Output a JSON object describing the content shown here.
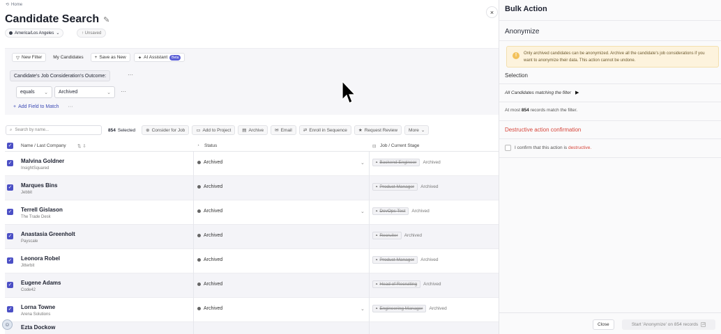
{
  "breadcrumb": {
    "home": "Home"
  },
  "page": {
    "title": "Candidate Search",
    "timezone": "America/Los Angeles",
    "unsaved": "Unsaved"
  },
  "filter_tabs": {
    "new_filter": "New Filter",
    "my_candidates": "My Candidates",
    "save_as_new": "Save as New",
    "ai_assistant": "AI Assistant",
    "beta": "Beta"
  },
  "filter": {
    "condition": "Candidate's Job Consideration's Outcome:",
    "operator": "equals",
    "value": "Archived",
    "add_field": "Add Field to Match"
  },
  "toolbar": {
    "search_placeholder": "Search by name...",
    "selected_count": "854",
    "selected_label": "Selected",
    "consider_for_job": "Consider for Job",
    "add_to_project": "Add to Project",
    "archive": "Archive",
    "email": "Email",
    "enroll": "Enroll in Sequence",
    "request_review": "Request Review",
    "more": "More"
  },
  "table": {
    "headers": {
      "name": "Name / Last Company",
      "status": "Status",
      "job": "Job / Current Stage"
    },
    "rows": [
      {
        "name": "Malvina Goldner",
        "company": "InsightSquared",
        "status": "Archived",
        "job": "Backend Engineer",
        "stage": "Archived"
      },
      {
        "name": "Marques Bins",
        "company": "Jebbit",
        "status": "Archived",
        "job": "Product Manager",
        "stage": "Archived"
      },
      {
        "name": "Terrell Gislason",
        "company": "The Trade Desk",
        "status": "Archived",
        "job": "DevOps Test",
        "stage": "Archived"
      },
      {
        "name": "Anastasia Greenholt",
        "company": "Payscale",
        "status": "Archived",
        "job": "Recruiter",
        "stage": "Archived"
      },
      {
        "name": "Leonora Robel",
        "company": "Jitterbit",
        "status": "Archived",
        "job": "Product Manager",
        "stage": "Archived"
      },
      {
        "name": "Eugene Adams",
        "company": "Code42",
        "status": "Archived",
        "job": "Head of Recruiting",
        "stage": "Archived"
      },
      {
        "name": "Lorna Towne",
        "company": "Arena Solutions",
        "status": "Archived",
        "job": "Engineering Manager",
        "stage": "Archived"
      },
      {
        "name": "Ezta Dockow",
        "company": "",
        "status": "",
        "job": "",
        "stage": ""
      }
    ]
  },
  "panel": {
    "title": "Bulk Action",
    "subtitle": "Anonymize",
    "warning": "Only archived candidates can be anonymized. Archive all the candidate's job considerations if you want to anonymize their data. This action cannot be undone.",
    "selection_heading": "Selection",
    "all_candidates": "All Candidates matching the filter",
    "at_most_prefix": "At most",
    "at_most_count": "854",
    "at_most_suffix": "records match the filter.",
    "destructive_heading": "Destructive action confirmation",
    "confirm_prefix": "I confirm that this action is",
    "confirm_word": "destructive.",
    "close": "Close",
    "start": "Start 'Anonymize' on 854 records"
  },
  "colors": {
    "accent": "#4b4fc5",
    "danger": "#d6453a",
    "warning_bg": "#fdf3dd"
  }
}
